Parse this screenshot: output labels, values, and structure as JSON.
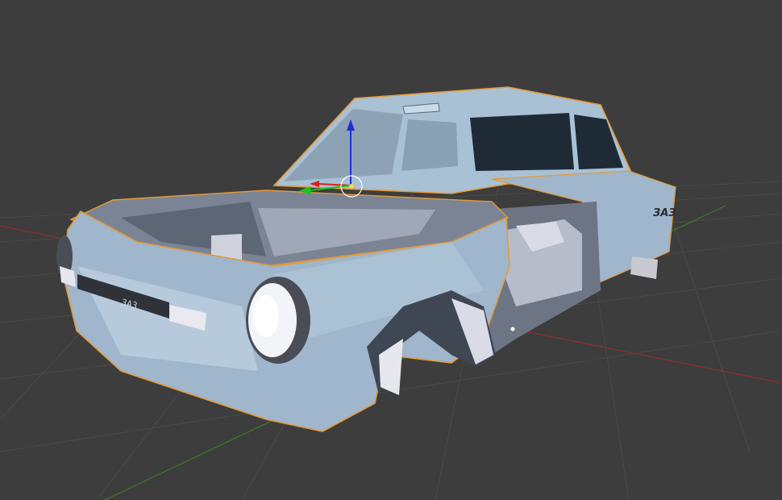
{
  "viewport": {
    "background": "#3d3d3d",
    "grid_color": "#4a4a4a",
    "x_axis_color": "#8c2f2f",
    "y_axis_color": "#3f7a2a"
  },
  "car": {
    "body_color": "#9fb6cc",
    "body_highlight": "#c9dbe9",
    "body_shadow": "#6d8499",
    "interior_color": "#8e96a6",
    "selection_outline": "#e49a3a",
    "badge_text": "ЗАЗ",
    "rear_badge_text": "ЗАЗ"
  },
  "gizmo": {
    "z_color": "#1f2fd6",
    "y_color": "#1cc41c",
    "x_color": "#d81f1f",
    "pivot_color": "#ffd24a",
    "ring_color": "#ffffff"
  }
}
